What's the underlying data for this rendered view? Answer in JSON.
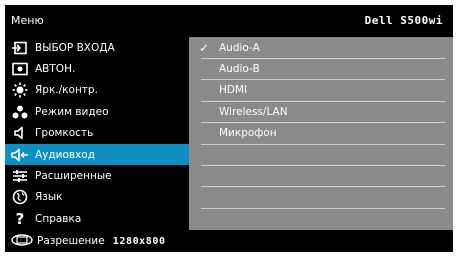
{
  "header": {
    "title": "Меню",
    "model": "Dell S500wi"
  },
  "menu": {
    "selected_index": 5,
    "items": [
      {
        "label": "ВЫБОР ВХОДА",
        "icon": "input-source-icon"
      },
      {
        "label": "АВТОН.",
        "icon": "auto-adjust-icon"
      },
      {
        "label": "Ярк./контр.",
        "icon": "brightness-icon"
      },
      {
        "label": "Режим видео",
        "icon": "video-mode-icon"
      },
      {
        "label": "Громкость",
        "icon": "volume-icon"
      },
      {
        "label": "Аудиовход",
        "icon": "audio-input-icon"
      },
      {
        "label": "Расширенные",
        "icon": "advanced-settings-icon"
      },
      {
        "label": "Язык",
        "icon": "language-globe-icon"
      },
      {
        "label": "Справка",
        "icon": "help-icon"
      }
    ]
  },
  "submenu": {
    "checked_index": 0,
    "options": [
      "Audio-A",
      "Audio-B",
      "HDMI",
      "Wireless/LAN",
      "Микрофон",
      "",
      "",
      "",
      ""
    ]
  },
  "footer": {
    "resolution_label": "Разрешение",
    "resolution_value": "1280x800"
  },
  "colors": {
    "selected": "#0e8fc3",
    "panel": "#8a8a8a",
    "background": "#000000"
  }
}
